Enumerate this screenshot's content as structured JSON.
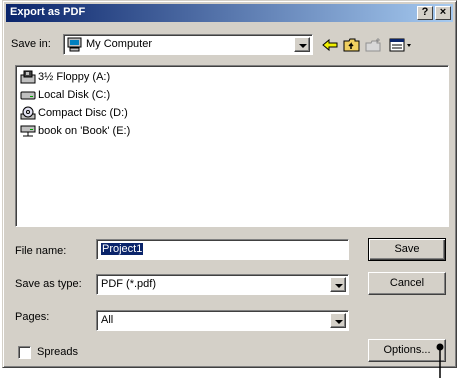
{
  "window": {
    "title": "Export as PDF",
    "help_label": "?",
    "close_label": "×"
  },
  "save_in": {
    "label": "Save in:",
    "value": "My Computer"
  },
  "toolbar": {
    "icons": [
      "back-arrow-icon",
      "up-folder-icon",
      "new-folder-icon",
      "view-menu-icon"
    ]
  },
  "files": [
    {
      "label": "3½ Floppy (A:)",
      "icon": "floppy-drive-icon"
    },
    {
      "label": "Local Disk (C:)",
      "icon": "hard-disk-icon"
    },
    {
      "label": "Compact Disc (D:)",
      "icon": "cd-drive-icon"
    },
    {
      "label": "book on 'Book' (E:)",
      "icon": "network-drive-icon"
    }
  ],
  "file_name": {
    "label": "File name:",
    "value": "Project1"
  },
  "save_as_type": {
    "label": "Save as type:",
    "value": "PDF (*.pdf)"
  },
  "pages": {
    "label": "Pages:",
    "value": "All"
  },
  "spreads": {
    "label": "Spreads",
    "checked": false
  },
  "buttons": {
    "save": "Save",
    "cancel": "Cancel",
    "options": "Options..."
  },
  "colors": {
    "title_start": "#0a246a",
    "title_end": "#a6caf0",
    "face": "#d4d0c8",
    "selection": "#0a246a"
  }
}
